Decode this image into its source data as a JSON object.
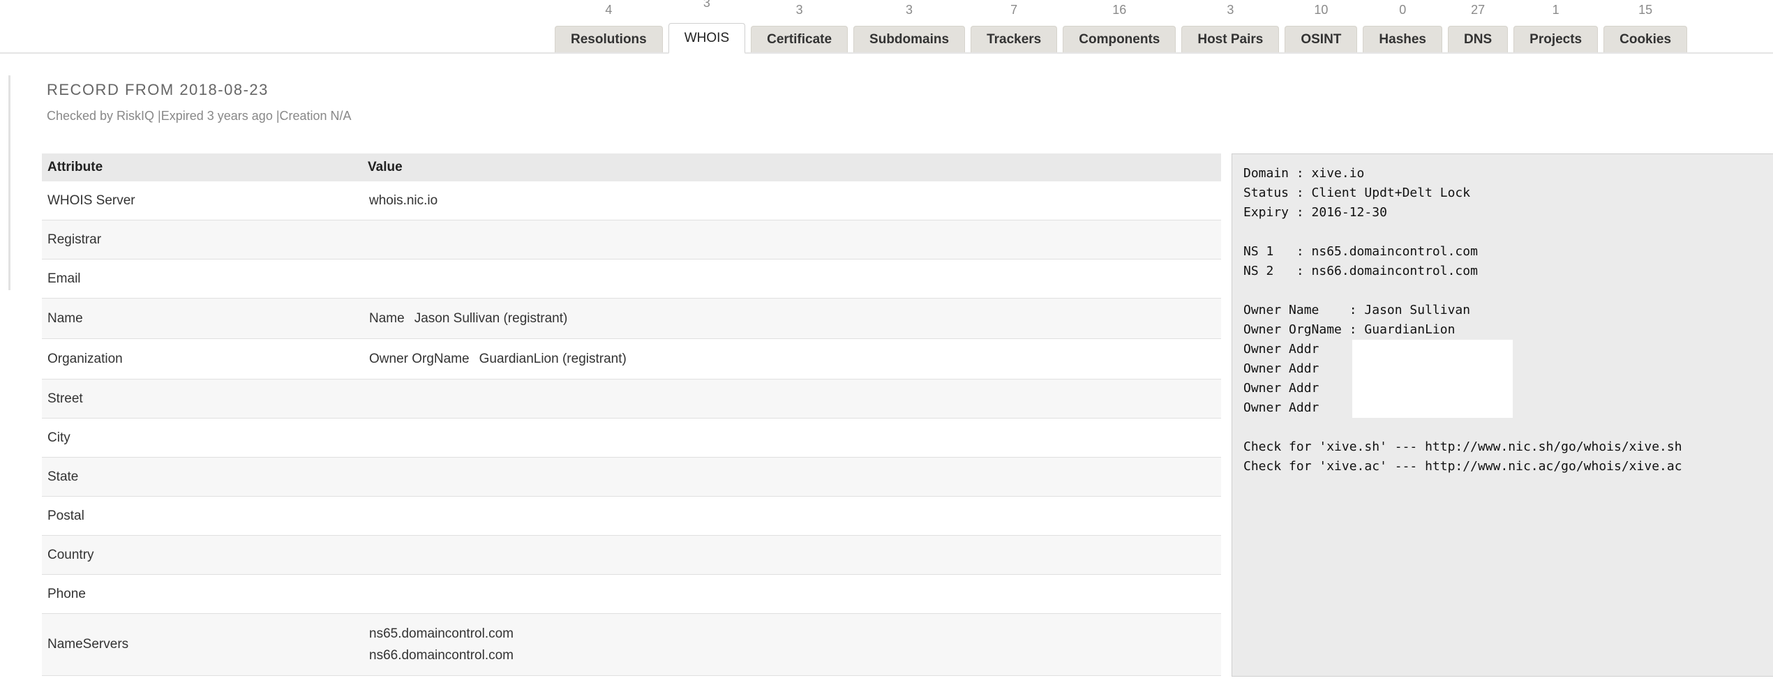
{
  "tabs": [
    {
      "label": "Resolutions",
      "count": "4"
    },
    {
      "label": "WHOIS",
      "count": "3",
      "active": true
    },
    {
      "label": "Certificate",
      "count": "3"
    },
    {
      "label": "Subdomains",
      "count": "3"
    },
    {
      "label": "Trackers",
      "count": "7"
    },
    {
      "label": "Components",
      "count": "16"
    },
    {
      "label": "Host Pairs",
      "count": "3"
    },
    {
      "label": "OSINT",
      "count": "10"
    },
    {
      "label": "Hashes",
      "count": "0"
    },
    {
      "label": "DNS",
      "count": "27"
    },
    {
      "label": "Projects",
      "count": "1"
    },
    {
      "label": "Cookies",
      "count": "15"
    }
  ],
  "record": {
    "title": "RECORD FROM 2018-08-23",
    "meta": "Checked by RiskIQ |Expired 3 years ago |Creation N/A"
  },
  "table": {
    "headers": [
      "Attribute",
      "Value"
    ],
    "rows": [
      {
        "attr": "WHOIS Server",
        "value": "whois.nic.io"
      },
      {
        "attr": "Registrar",
        "value": ""
      },
      {
        "attr": "Email",
        "value": ""
      },
      {
        "attr": "Name",
        "value_label": "Name",
        "value": "Jason Sullivan (registrant)"
      },
      {
        "attr": "Organization",
        "value_label": "Owner OrgName",
        "value": "GuardianLion (registrant)"
      },
      {
        "attr": "Street",
        "value": ""
      },
      {
        "attr": "City",
        "value": ""
      },
      {
        "attr": "State",
        "value": ""
      },
      {
        "attr": "Postal",
        "value": ""
      },
      {
        "attr": "Country",
        "value": ""
      },
      {
        "attr": "Phone",
        "value": ""
      },
      {
        "attr": "NameServers",
        "values": [
          "ns65.domaincontrol.com",
          "ns66.domaincontrol.com"
        ]
      }
    ]
  },
  "raw_whois": {
    "lines": [
      "Domain : xive.io",
      "Status : Client Updt+Delt Lock",
      "Expiry : 2016-12-30",
      "",
      "NS 1   : ns65.domaincontrol.com",
      "NS 2   : ns66.domaincontrol.com",
      "",
      "Owner Name    : Jason Sullivan",
      "Owner OrgName : GuardianLion",
      "Owner Addr",
      "Owner Addr",
      "Owner Addr",
      "Owner Addr",
      "",
      "Check for 'xive.sh' --- http://www.nic.sh/go/whois/xive.sh",
      "Check for 'xive.ac' --- http://www.nic.ac/go/whois/xive.ac"
    ]
  }
}
